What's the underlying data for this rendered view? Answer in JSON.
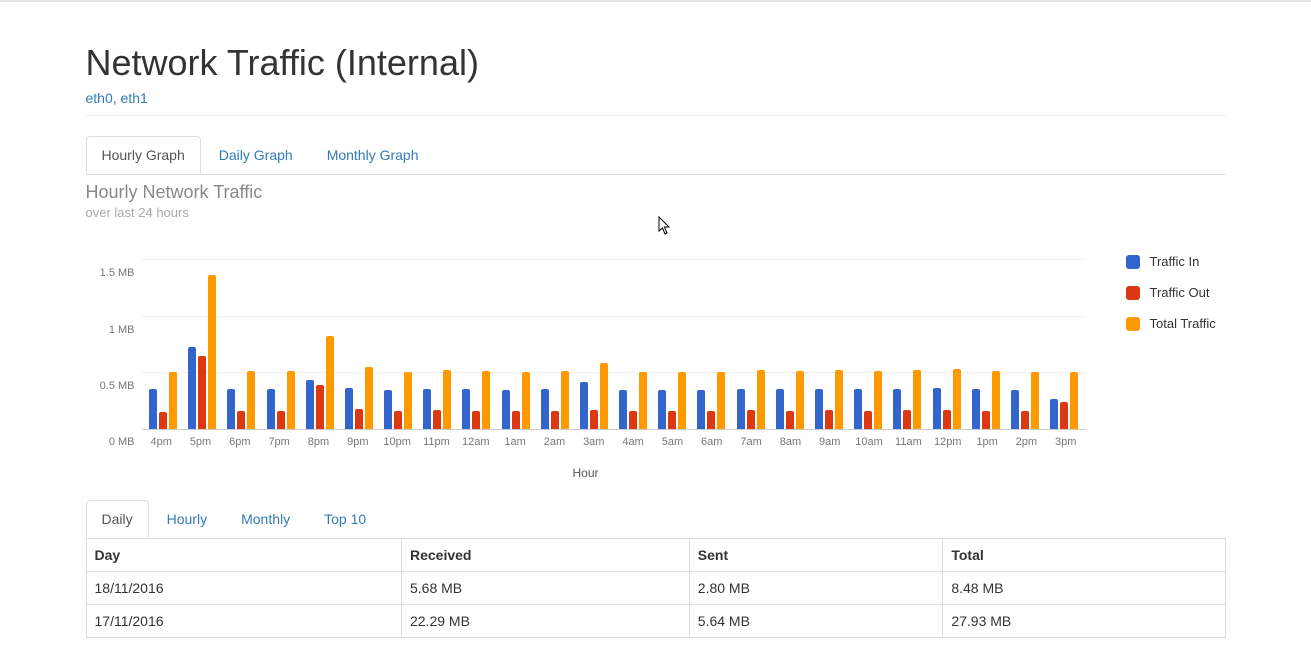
{
  "page": {
    "title": "Network Traffic (Internal)",
    "subtitle": "eth0, eth1"
  },
  "graph_tabs": [
    {
      "id": "graph-tab-hourly",
      "label": "Hourly Graph",
      "active": true
    },
    {
      "id": "graph-tab-daily",
      "label": "Daily Graph",
      "active": false
    },
    {
      "id": "graph-tab-monthly",
      "label": "Monthly Graph",
      "active": false
    }
  ],
  "chart_header": {
    "title": "Hourly Network Traffic",
    "subtitle": "over last 24 hours"
  },
  "chart_data": {
    "type": "bar",
    "title": "Hourly Network Traffic",
    "xlabel": "Hour",
    "ylabel": "",
    "y_ticks": [
      "0 MB",
      "0.5 MB",
      "1 MB",
      "1.5 MB"
    ],
    "ylim": [
      0,
      1.6
    ],
    "categories": [
      "4pm",
      "5pm",
      "6pm",
      "7pm",
      "8pm",
      "9pm",
      "10pm",
      "11pm",
      "12am",
      "1am",
      "2am",
      "3am",
      "4am",
      "5am",
      "6am",
      "7am",
      "8am",
      "9am",
      "10am",
      "11am",
      "12pm",
      "1pm",
      "2pm",
      "3pm"
    ],
    "series": [
      {
        "name": "Traffic In",
        "color": "#3366cc",
        "values": [
          0.36,
          0.73,
          0.36,
          0.36,
          0.44,
          0.37,
          0.35,
          0.36,
          0.36,
          0.35,
          0.36,
          0.42,
          0.35,
          0.35,
          0.35,
          0.36,
          0.36,
          0.36,
          0.36,
          0.36,
          0.37,
          0.36,
          0.35,
          0.27
        ]
      },
      {
        "name": "Traffic Out",
        "color": "#dc3912",
        "values": [
          0.15,
          0.65,
          0.16,
          0.16,
          0.39,
          0.18,
          0.16,
          0.17,
          0.16,
          0.16,
          0.16,
          0.17,
          0.16,
          0.16,
          0.16,
          0.17,
          0.16,
          0.17,
          0.16,
          0.17,
          0.17,
          0.16,
          0.16,
          0.24
        ]
      },
      {
        "name": "Total Traffic",
        "color": "#ff9900",
        "values": [
          0.51,
          1.38,
          0.52,
          0.52,
          0.83,
          0.55,
          0.51,
          0.53,
          0.52,
          0.51,
          0.52,
          0.59,
          0.51,
          0.51,
          0.51,
          0.53,
          0.52,
          0.53,
          0.52,
          0.53,
          0.54,
          0.52,
          0.51,
          0.51
        ]
      }
    ]
  },
  "table_tabs": [
    {
      "id": "table-tab-daily",
      "label": "Daily",
      "active": true
    },
    {
      "id": "table-tab-hourly",
      "label": "Hourly",
      "active": false
    },
    {
      "id": "table-tab-monthly",
      "label": "Monthly",
      "active": false
    },
    {
      "id": "table-tab-top10",
      "label": "Top 10",
      "active": false
    }
  ],
  "table": {
    "columns": [
      "Day",
      "Received",
      "Sent",
      "Total"
    ],
    "rows": [
      {
        "day": "18/11/2016",
        "received": "5.68 MB",
        "sent": "2.80 MB",
        "total": "8.48 MB"
      },
      {
        "day": "17/11/2016",
        "received": "22.29 MB",
        "sent": "5.64 MB",
        "total": "27.93 MB"
      }
    ]
  }
}
